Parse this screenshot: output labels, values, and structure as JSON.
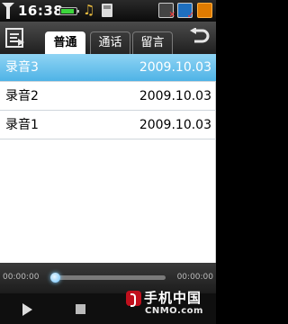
{
  "status_bar": {
    "time": "16:38",
    "battery_level": 0.85,
    "icons": [
      "signal-icon",
      "battery-icon",
      "music-icon",
      "memory-card-icon",
      "network-icon",
      "mail-icon",
      "rss-icon"
    ]
  },
  "toolbar": {
    "menu_icon": "menu-icon",
    "back_icon": "back-icon",
    "tabs": [
      {
        "label": "普通",
        "active": true
      },
      {
        "label": "通话",
        "active": false
      },
      {
        "label": "留言",
        "active": false
      }
    ]
  },
  "recordings": [
    {
      "name": "录音3",
      "date": "2009.10.03",
      "selected": true
    },
    {
      "name": "录音2",
      "date": "2009.10.03",
      "selected": false
    },
    {
      "name": "录音1",
      "date": "2009.10.03",
      "selected": false
    }
  ],
  "player": {
    "current_time": "00:00:00",
    "total_time": "00:00:00",
    "progress": 0.0,
    "icons": [
      "play-icon",
      "stop-icon"
    ]
  },
  "watermark": {
    "cn": "手机中国",
    "en": "CNMO.com"
  },
  "colors": {
    "selection": "#4fb3e6",
    "progress_accent": "#49b4ff",
    "battery": "#3cd63c",
    "brand_red": "#c0101d"
  }
}
